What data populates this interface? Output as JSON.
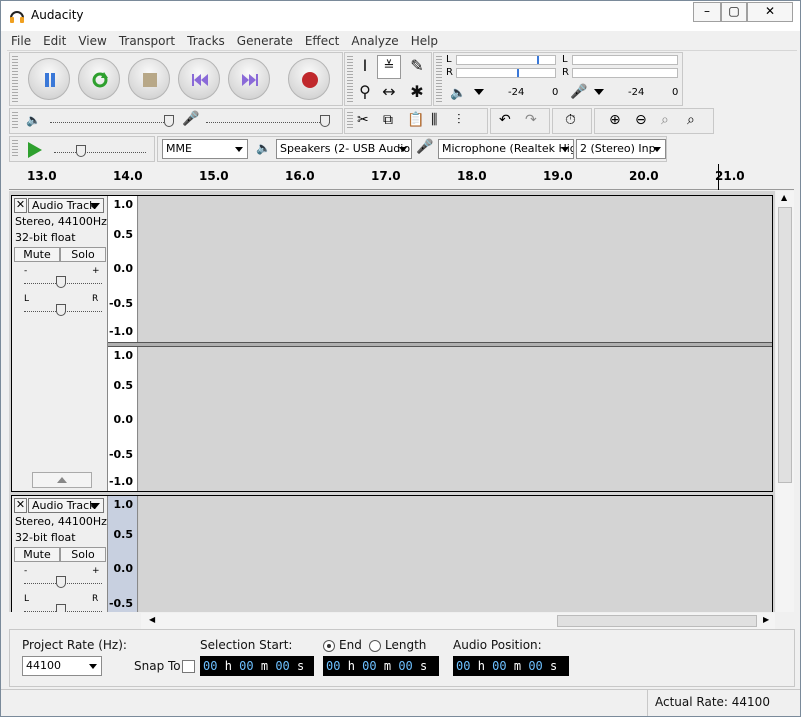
{
  "window": {
    "title": "Audacity"
  },
  "menu": [
    "File",
    "Edit",
    "View",
    "Transport",
    "Tracks",
    "Generate",
    "Effect",
    "Analyze",
    "Help"
  ],
  "meters": {
    "ticks_play": [
      "-24",
      "0"
    ],
    "ticks_rec": [
      "-24",
      "0"
    ],
    "channels": [
      "L",
      "R"
    ]
  },
  "device": {
    "host": "MME",
    "output": "Speakers (2- USB Audio",
    "input": "Microphone (Realtek Hig",
    "channels": "2 (Stereo) Inp"
  },
  "ruler": [
    "13.0",
    "14.0",
    "15.0",
    "16.0",
    "17.0",
    "18.0",
    "19.0",
    "20.0",
    "21.0"
  ],
  "tracks": [
    {
      "name": "Audio Track",
      "info1": "Stereo, 44100Hz",
      "info2": "32-bit float",
      "mute": "Mute",
      "solo": "Solo",
      "gain_minus": "-",
      "gain_plus": "+",
      "pan_left": "L",
      "pan_right": "R",
      "scale": [
        "1.0",
        "0.5",
        "0.0",
        "-0.5",
        "-1.0"
      ]
    },
    {
      "name": "Audio Track",
      "info1": "Stereo, 44100Hz",
      "info2": "32-bit float",
      "mute": "Mute",
      "solo": "Solo",
      "gain_minus": "-",
      "gain_plus": "+",
      "pan_left": "L",
      "pan_right": "R",
      "scale": [
        "1.0",
        "0.5",
        "0.0",
        "-0.5"
      ]
    }
  ],
  "selection": {
    "project_rate_label": "Project Rate (Hz):",
    "project_rate_value": "44100",
    "snap_to": "Snap To",
    "selection_start": "Selection Start:",
    "end_label": "End",
    "length_label": "Length",
    "audio_position": "Audio Position:",
    "time_start": [
      "00",
      "h",
      "00",
      "m",
      "00",
      "s"
    ],
    "time_end": [
      "00",
      "h",
      "00",
      "m",
      "00",
      "s"
    ],
    "time_pos": [
      "00",
      "h",
      "00",
      "m",
      "00",
      "s"
    ]
  },
  "status": {
    "actual_rate": "Actual Rate: 44100"
  },
  "colors": {
    "accent_blue": "#3a78d8",
    "record_red": "#c0282c",
    "play_green": "#2ea02e"
  }
}
